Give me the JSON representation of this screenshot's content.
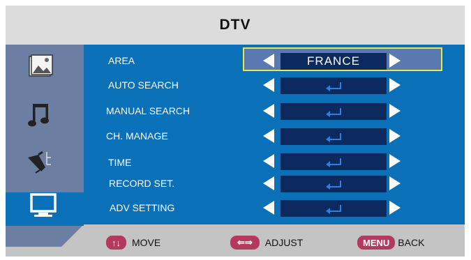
{
  "title": "DTV",
  "sidebar": {
    "icons": [
      "picture-icon",
      "music-icon",
      "settings-icon",
      "tv-icon"
    ],
    "selected": "tv-icon"
  },
  "menu": [
    {
      "label": "AREA",
      "value": "FRANCE",
      "type": "value",
      "highlighted": true
    },
    {
      "label": "AUTO SEARCH",
      "type": "enter"
    },
    {
      "label": "MANUAL SEARCH",
      "type": "enter"
    },
    {
      "label": "CH. MANAGE",
      "type": "enter"
    },
    {
      "label": "TIME",
      "type": "enter"
    },
    {
      "label": "RECORD SET.",
      "type": "enter"
    },
    {
      "label": "ADV SETTING",
      "type": "enter"
    }
  ],
  "footer": {
    "move": {
      "key": "↑↓",
      "label": "MOVE"
    },
    "adjust": {
      "key": "⇐⇒",
      "label": "ADJUST"
    },
    "back": {
      "key": "MENU",
      "label": "BACK"
    }
  },
  "colors": {
    "title_bg": "#dcdcdc",
    "sidebar": "#6c7fa3",
    "content": "#0a70b8",
    "value_box": "#0c2a5e",
    "highlight_border": "#e8e84a",
    "button": "#b33a5e"
  }
}
